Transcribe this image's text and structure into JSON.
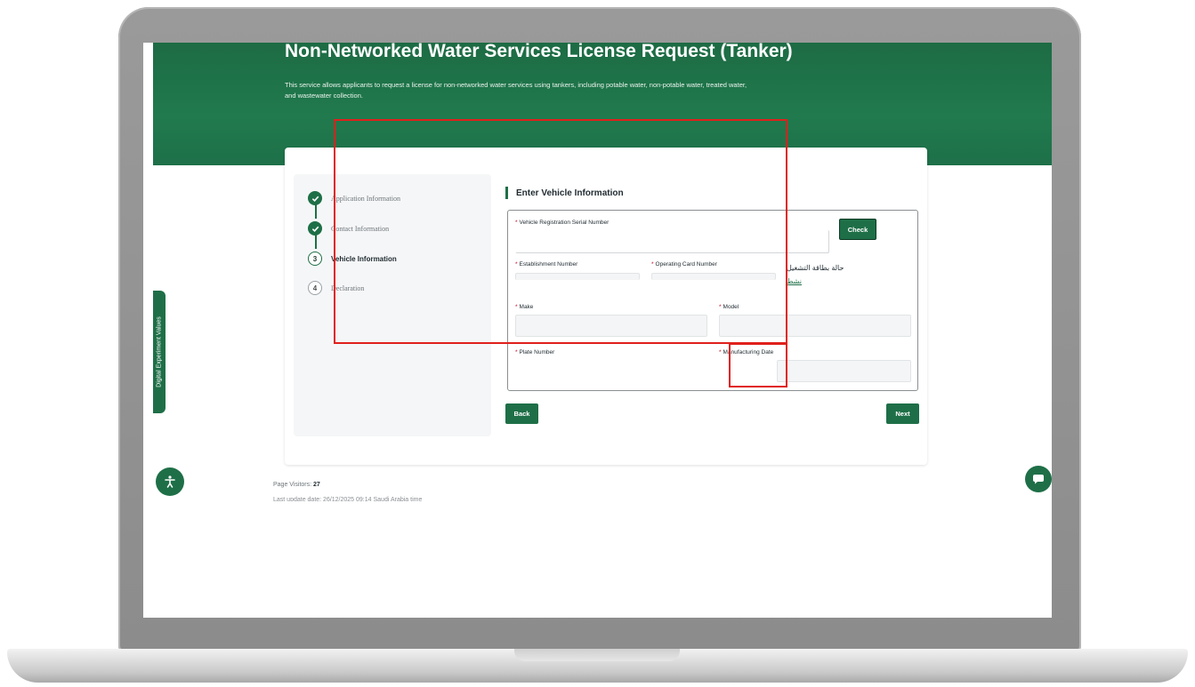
{
  "page": {
    "title": "Non-Networked Water Services License Request (Tanker)",
    "description": "This service allows applicants to request a license for non-networked water services using tankers, including potable water, non-potable water, treated water, and wastewater collection."
  },
  "side_tab": {
    "label": "Digital Experiment Values"
  },
  "steps": [
    {
      "number": "",
      "label": "Application Information",
      "state": "done"
    },
    {
      "number": "",
      "label": "Contact Information",
      "state": "done"
    },
    {
      "number": "3",
      "label": "Vehicle Information",
      "state": "current"
    },
    {
      "number": "4",
      "label": "Declaration",
      "state": "todo"
    }
  ],
  "form": {
    "title": "Enter Vehicle Information",
    "required_mark": "*",
    "vehicle_registration_label": "Vehicle Registration Serial Number",
    "check_button": "Check",
    "establishment_number_label": "Establishment Number",
    "operating_card_number_label": "Operating Card Number",
    "operating_card_status_label": "حالة بطاقة التشغيل",
    "operating_card_status_value": "نشط",
    "make_label": "Make",
    "model_label": "Model",
    "plate_number_label": "Plate Number",
    "manufacturing_date_label": "Manufacturing Date"
  },
  "buttons": {
    "back": "Back",
    "next": "Next"
  },
  "footer": {
    "visitors_label": "Page Visitors:",
    "visitors_count": "27",
    "last_update": "Last update date: 26/12/2025 09:14 Saudi Arabia time"
  },
  "colors": {
    "brand_green": "#1e6f47",
    "highlight_red": "#e0201c",
    "required_red": "#d0021b"
  },
  "icons": {
    "done_step": "check-icon",
    "accessibility": "accessibility-icon",
    "chat": "chat-icon"
  }
}
